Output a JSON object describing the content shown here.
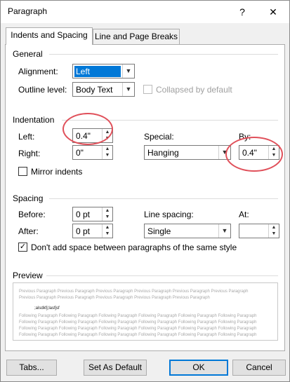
{
  "window": {
    "title": "Paragraph",
    "help_label": "?",
    "close_label": "✕"
  },
  "tabs": [
    {
      "label": "Indents and Spacing",
      "active": true
    },
    {
      "label": "Line and Page Breaks",
      "active": false
    }
  ],
  "general": {
    "heading": "General",
    "alignment_label": "Alignment:",
    "alignment_value": "Left",
    "outline_label": "Outline level:",
    "outline_value": "Body Text",
    "collapsed_label": "Collapsed by default",
    "collapsed_checked": false
  },
  "indentation": {
    "heading": "Indentation",
    "left_label": "Left:",
    "left_value": "0.4\"",
    "right_label": "Right:",
    "right_value": "0\"",
    "special_label": "Special:",
    "special_value": "Hanging",
    "by_label": "By:",
    "by_value": "0.4\"",
    "mirror_label": "Mirror indents",
    "mirror_checked": false
  },
  "spacing": {
    "heading": "Spacing",
    "before_label": "Before:",
    "before_value": "0 pt",
    "after_label": "After:",
    "after_value": "0 pt",
    "line_spacing_label": "Line spacing:",
    "line_spacing_value": "Single",
    "at_label": "At:",
    "at_value": "",
    "dont_add_label": "Don't add space between paragraphs of the same style",
    "dont_add_checked": true
  },
  "preview": {
    "heading": "Preview",
    "previous_line": "Previous Paragraph Previous Paragraph Previous Paragraph Previous Paragraph Previous Paragraph Previous Paragraph",
    "previous_line2": "Previous Paragraph Previous Paragraph Previous Paragraph Previous Paragraph Previous Paragraph",
    "sample_text": ";alsdkfj;lasfjsf",
    "following_line": "Following Paragraph Following Paragraph Following Paragraph Following Paragraph Following Paragraph Following Paragraph"
  },
  "buttons": {
    "tabs_label": "Tabs...",
    "set_default_label": "Set As Default",
    "ok_label": "OK",
    "cancel_label": "Cancel"
  },
  "colors": {
    "accent": "#0078d7",
    "annotation": "#e0505a"
  }
}
